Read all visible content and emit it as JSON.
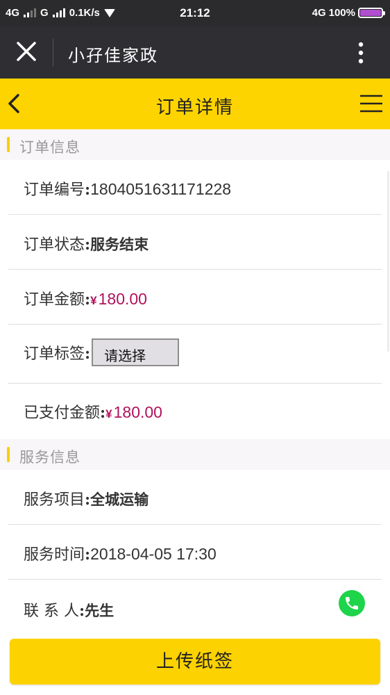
{
  "status_bar": {
    "network_left": "4G",
    "network_mid": "G",
    "speed": "0.1K/s",
    "time": "21:12",
    "network_right": "4G",
    "battery": "100%"
  },
  "nav": {
    "title": "小孖佳家政"
  },
  "header": {
    "title": "订单详情"
  },
  "order_section": {
    "title": "订单信息",
    "order_no_label": "订单编号",
    "order_no": "1804051631171228",
    "status_label": "订单状态",
    "status": "服务结束",
    "amount_label": "订单金额",
    "currency": "¥",
    "amount": "180.00",
    "tag_label": "订单标签",
    "tag_select": "请选择",
    "paid_label": "已支付金额",
    "paid": "180.00"
  },
  "service_section": {
    "title": "服务信息",
    "item_label": "服务项目",
    "item": "全城运输",
    "time_label": "服务时间",
    "time": "2018-04-05 17:30",
    "contact_label": "联 系 人",
    "contact": "先生"
  },
  "footer": {
    "upload_label": "上传纸签"
  },
  "colors": {
    "accent": "#fed400",
    "price": "#b0125c",
    "call": "#1ed44a"
  }
}
